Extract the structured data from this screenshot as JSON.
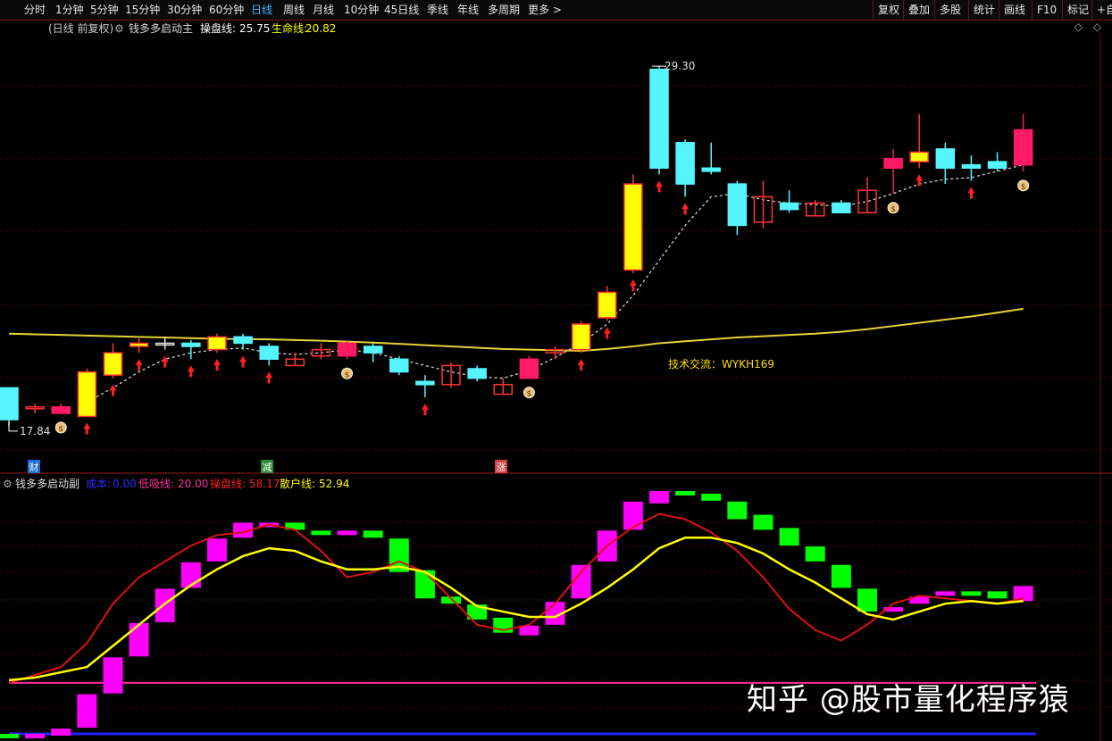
{
  "toolbar": {
    "periods": [
      "分时",
      "1分钟",
      "5分钟",
      "15分钟",
      "30分钟",
      "60分钟",
      "日线",
      "周线",
      "月线",
      "10分钟",
      "45日线",
      "季线",
      "年线",
      "多周期",
      "更多 >"
    ],
    "active_period": "日线",
    "right_buttons": [
      "复权",
      "叠加",
      "多股",
      "统计",
      "画线",
      "F10",
      "标记",
      "+自"
    ]
  },
  "main_header": {
    "period_label": "(日线 前复权)",
    "indicator_name": "钱多多启动主",
    "line1_label": "操盘线:",
    "line1_value": "25.75",
    "line2_label": "生命线:",
    "line2_value": "20.82",
    "corner": "◇ ◇"
  },
  "sub_header": {
    "indicator_name": "钱多多启动副",
    "l1_label": "成本:",
    "l1_value": "0.00",
    "l2_label": "低吸线:",
    "l2_value": "20.00",
    "l3_label": "操盘线:",
    "l3_value": "58.17",
    "l4_label": "散户线:",
    "l4_value": "52.94"
  },
  "annotations": {
    "high_label": "29.30",
    "low_label": "17.84",
    "contact_text": "技术交流：WYKH169",
    "marker_cai": "财",
    "marker_jian": "减",
    "marker_zhang": "涨"
  },
  "watermark": "知乎 @股市量化程序猿",
  "colors": {
    "up": "#ff1a66",
    "down": "#55f5ff",
    "yellow": "#ffff00",
    "hollow_up": "#ff3333",
    "gold": "#e6d23a",
    "magenta": "#ff00ff",
    "green": "#00ff00",
    "red": "#dd1111",
    "arrow": "#ff2020"
  },
  "chart_data": [
    {
      "type": "candlestick",
      "title": "钱多多启动主",
      "y_range": [
        16.8,
        30.2
      ],
      "candles": [
        {
          "o": 19.2,
          "c": 18.2,
          "h": 19.2,
          "l": 18.0,
          "style": "down"
        },
        {
          "o": 18.6,
          "c": 18.6,
          "h": 18.7,
          "l": 18.4,
          "style": "hollow"
        },
        {
          "o": 18.4,
          "c": 18.6,
          "h": 18.7,
          "l": 18.4,
          "style": "up"
        },
        {
          "o": 18.3,
          "c": 19.7,
          "h": 19.8,
          "l": 18.3,
          "style": "yellow"
        },
        {
          "o": 19.6,
          "c": 20.3,
          "h": 20.6,
          "l": 19.5,
          "style": "yellow"
        },
        {
          "o": 20.5,
          "c": 20.6,
          "h": 20.8,
          "l": 20.3,
          "style": "yellow"
        },
        {
          "o": 20.6,
          "c": 20.6,
          "h": 20.8,
          "l": 20.4,
          "style": "doji"
        },
        {
          "o": 20.6,
          "c": 20.5,
          "h": 20.7,
          "l": 20.1,
          "style": "down"
        },
        {
          "o": 20.4,
          "c": 20.8,
          "h": 20.9,
          "l": 20.3,
          "style": "yellow"
        },
        {
          "o": 20.8,
          "c": 20.6,
          "h": 20.9,
          "l": 20.4,
          "style": "down"
        },
        {
          "o": 20.5,
          "c": 20.1,
          "h": 20.6,
          "l": 19.9,
          "style": "down"
        },
        {
          "o": 19.9,
          "c": 20.1,
          "h": 20.3,
          "l": 19.9,
          "style": "hollow"
        },
        {
          "o": 20.2,
          "c": 20.4,
          "h": 20.6,
          "l": 20.1,
          "style": "hollow"
        },
        {
          "o": 20.2,
          "c": 20.6,
          "h": 20.7,
          "l": 20.1,
          "style": "up"
        },
        {
          "o": 20.5,
          "c": 20.3,
          "h": 20.6,
          "l": 20.0,
          "style": "down"
        },
        {
          "o": 20.1,
          "c": 19.7,
          "h": 20.2,
          "l": 19.6,
          "style": "down"
        },
        {
          "o": 19.4,
          "c": 19.3,
          "h": 19.6,
          "l": 18.9,
          "style": "down"
        },
        {
          "o": 19.3,
          "c": 19.9,
          "h": 20.0,
          "l": 19.2,
          "style": "hollow"
        },
        {
          "o": 19.8,
          "c": 19.5,
          "h": 19.9,
          "l": 19.4,
          "style": "down"
        },
        {
          "o": 19.0,
          "c": 19.3,
          "h": 19.5,
          "l": 19.0,
          "style": "hollow"
        },
        {
          "o": 19.5,
          "c": 20.1,
          "h": 20.2,
          "l": 19.5,
          "style": "up"
        },
        {
          "o": 20.3,
          "c": 20.4,
          "h": 20.5,
          "l": 20.1,
          "style": "hollow"
        },
        {
          "o": 20.4,
          "c": 21.2,
          "h": 21.3,
          "l": 20.3,
          "style": "yellow"
        },
        {
          "o": 21.4,
          "c": 22.2,
          "h": 22.4,
          "l": 21.3,
          "style": "yellow"
        },
        {
          "o": 22.9,
          "c": 25.6,
          "h": 25.9,
          "l": 22.8,
          "style": "yellow"
        },
        {
          "o": 26.1,
          "c": 29.2,
          "h": 29.3,
          "l": 25.9,
          "style": "down"
        },
        {
          "o": 26.9,
          "c": 25.6,
          "h": 27.0,
          "l": 25.2,
          "style": "down"
        },
        {
          "o": 26.1,
          "c": 26.0,
          "h": 26.9,
          "l": 25.9,
          "style": "down"
        },
        {
          "o": 25.6,
          "c": 24.3,
          "h": 25.7,
          "l": 24.0,
          "style": "down"
        },
        {
          "o": 24.4,
          "c": 25.2,
          "h": 25.7,
          "l": 24.2,
          "style": "hollow"
        },
        {
          "o": 25.0,
          "c": 24.8,
          "h": 25.4,
          "l": 24.7,
          "style": "down"
        },
        {
          "o": 25.0,
          "c": 24.6,
          "h": 25.1,
          "l": 24.6,
          "style": "hollow"
        },
        {
          "o": 25.0,
          "c": 24.7,
          "h": 25.1,
          "l": 24.7,
          "style": "down"
        },
        {
          "o": 24.7,
          "c": 25.4,
          "h": 25.8,
          "l": 24.7,
          "style": "hollow"
        },
        {
          "o": 26.1,
          "c": 26.4,
          "h": 26.7,
          "l": 25.3,
          "style": "up"
        },
        {
          "o": 26.3,
          "c": 26.6,
          "h": 27.8,
          "l": 26.1,
          "style": "yellow"
        },
        {
          "o": 26.7,
          "c": 26.1,
          "h": 26.9,
          "l": 25.6,
          "style": "down"
        },
        {
          "o": 26.2,
          "c": 26.1,
          "h": 26.5,
          "l": 25.7,
          "style": "down"
        },
        {
          "o": 26.3,
          "c": 26.1,
          "h": 26.6,
          "l": 26.0,
          "style": "down"
        },
        {
          "o": 26.2,
          "c": 27.3,
          "h": 27.8,
          "l": 26.0,
          "style": "up"
        }
      ],
      "series": [
        {
          "name": "操盘线",
          "style": "dashed",
          "values": [
            null,
            null,
            null,
            18.75,
            19.2,
            19.7,
            20.1,
            20.3,
            20.4,
            20.45,
            20.3,
            20.25,
            20.3,
            20.4,
            20.3,
            20.1,
            19.9,
            19.7,
            19.55,
            19.5,
            19.75,
            20.15,
            20.6,
            21.2,
            22.1,
            23.2,
            24.3,
            25.2,
            25.3,
            25.1,
            25.0,
            24.95,
            24.9,
            25.05,
            25.3,
            25.6,
            25.75,
            25.8,
            26.0,
            26.2
          ]
        },
        {
          "name": "生命线",
          "style": "solid",
          "values": [
            20.9,
            20.88,
            20.86,
            20.84,
            20.82,
            20.8,
            20.78,
            20.76,
            20.74,
            20.73,
            20.72,
            20.7,
            20.68,
            20.65,
            20.62,
            20.58,
            20.54,
            20.5,
            20.46,
            20.42,
            20.4,
            20.38,
            20.36,
            20.42,
            20.5,
            20.6,
            20.66,
            20.72,
            20.78,
            20.82,
            20.86,
            20.9,
            20.96,
            21.04,
            21.14,
            21.24,
            21.34,
            21.44,
            21.56,
            21.68
          ]
        }
      ],
      "signals": {
        "up_arrow_indices": [
          3,
          4,
          5,
          6,
          7,
          8,
          9,
          10,
          16,
          22,
          23,
          24,
          25,
          26,
          35,
          37
        ],
        "money_bag_indices": [
          2,
          13,
          20,
          34,
          39
        ]
      }
    },
    {
      "type": "bar+line",
      "title": "钱多多启动副",
      "y_range": [
        0,
        92
      ],
      "bars": [
        {
          "o": 0,
          "c": 0,
          "color": "green"
        },
        {
          "o": 0,
          "c": 0,
          "color": "magenta"
        },
        {
          "o": 0,
          "c": 2,
          "color": "magenta"
        },
        {
          "o": 3,
          "c": 15,
          "color": "magenta"
        },
        {
          "o": 16,
          "c": 29,
          "color": "magenta"
        },
        {
          "o": 30,
          "c": 42,
          "color": "magenta"
        },
        {
          "o": 43,
          "c": 55,
          "color": "magenta"
        },
        {
          "o": 56,
          "c": 65,
          "color": "magenta"
        },
        {
          "o": 66,
          "c": 74,
          "color": "magenta"
        },
        {
          "o": 75,
          "c": 80,
          "color": "magenta"
        },
        {
          "o": 80,
          "c": 80,
          "color": "magenta"
        },
        {
          "o": 80,
          "c": 78,
          "color": "green"
        },
        {
          "o": 77,
          "c": 76,
          "color": "green"
        },
        {
          "o": 76,
          "c": 77,
          "color": "magenta"
        },
        {
          "o": 77,
          "c": 75,
          "color": "green"
        },
        {
          "o": 74,
          "c": 62,
          "color": "green"
        },
        {
          "o": 62,
          "c": 52,
          "color": "green"
        },
        {
          "o": 52,
          "c": 50,
          "color": "green"
        },
        {
          "o": 49,
          "c": 44,
          "color": "green"
        },
        {
          "o": 44,
          "c": 39,
          "color": "green"
        },
        {
          "o": 38,
          "c": 41,
          "color": "magenta"
        },
        {
          "o": 42,
          "c": 50,
          "color": "magenta"
        },
        {
          "o": 52,
          "c": 64,
          "color": "magenta"
        },
        {
          "o": 66,
          "c": 77,
          "color": "magenta"
        },
        {
          "o": 78,
          "c": 88,
          "color": "magenta"
        },
        {
          "o": 88,
          "c": 92,
          "color": "magenta"
        },
        {
          "o": 92,
          "c": 91,
          "color": "green"
        },
        {
          "o": 91,
          "c": 89,
          "color": "green"
        },
        {
          "o": 88,
          "c": 82,
          "color": "green"
        },
        {
          "o": 83,
          "c": 78,
          "color": "green"
        },
        {
          "o": 78,
          "c": 72,
          "color": "green"
        },
        {
          "o": 71,
          "c": 66,
          "color": "green"
        },
        {
          "o": 64,
          "c": 56,
          "color": "green"
        },
        {
          "o": 55,
          "c": 47,
          "color": "green"
        },
        {
          "o": 47,
          "c": 48,
          "color": "magenta"
        },
        {
          "o": 50,
          "c": 52,
          "color": "magenta"
        },
        {
          "o": 53,
          "c": 54,
          "color": "magenta"
        },
        {
          "o": 54,
          "c": 53,
          "color": "green"
        },
        {
          "o": 54,
          "c": 52,
          "color": "green"
        },
        {
          "o": 51,
          "c": 56,
          "color": "magenta"
        }
      ],
      "series": [
        {
          "name": "操盘线",
          "values": [
            20,
            23,
            26,
            35,
            50,
            60,
            66,
            72,
            76,
            77,
            80,
            78,
            70,
            60,
            62,
            66,
            62,
            52,
            42,
            40,
            42,
            50,
            62,
            72,
            79,
            84,
            82,
            77,
            70,
            60,
            48,
            40,
            36,
            42,
            50,
            53,
            52,
            51,
            50,
            52
          ]
        },
        {
          "name": "散户线",
          "values": [
            21,
            22,
            24,
            26,
            34,
            42,
            50,
            57,
            63,
            68,
            71,
            70,
            66,
            63,
            63,
            64,
            62,
            56,
            49,
            47,
            45,
            45,
            50,
            56,
            63,
            71,
            75,
            75,
            73,
            69,
            63,
            58,
            52,
            46,
            44,
            47,
            50,
            51,
            50,
            51
          ]
        }
      ],
      "reference_lines": [
        {
          "name": "低吸线",
          "value": 20
        },
        {
          "name": "成本",
          "value": 0
        }
      ]
    }
  ]
}
